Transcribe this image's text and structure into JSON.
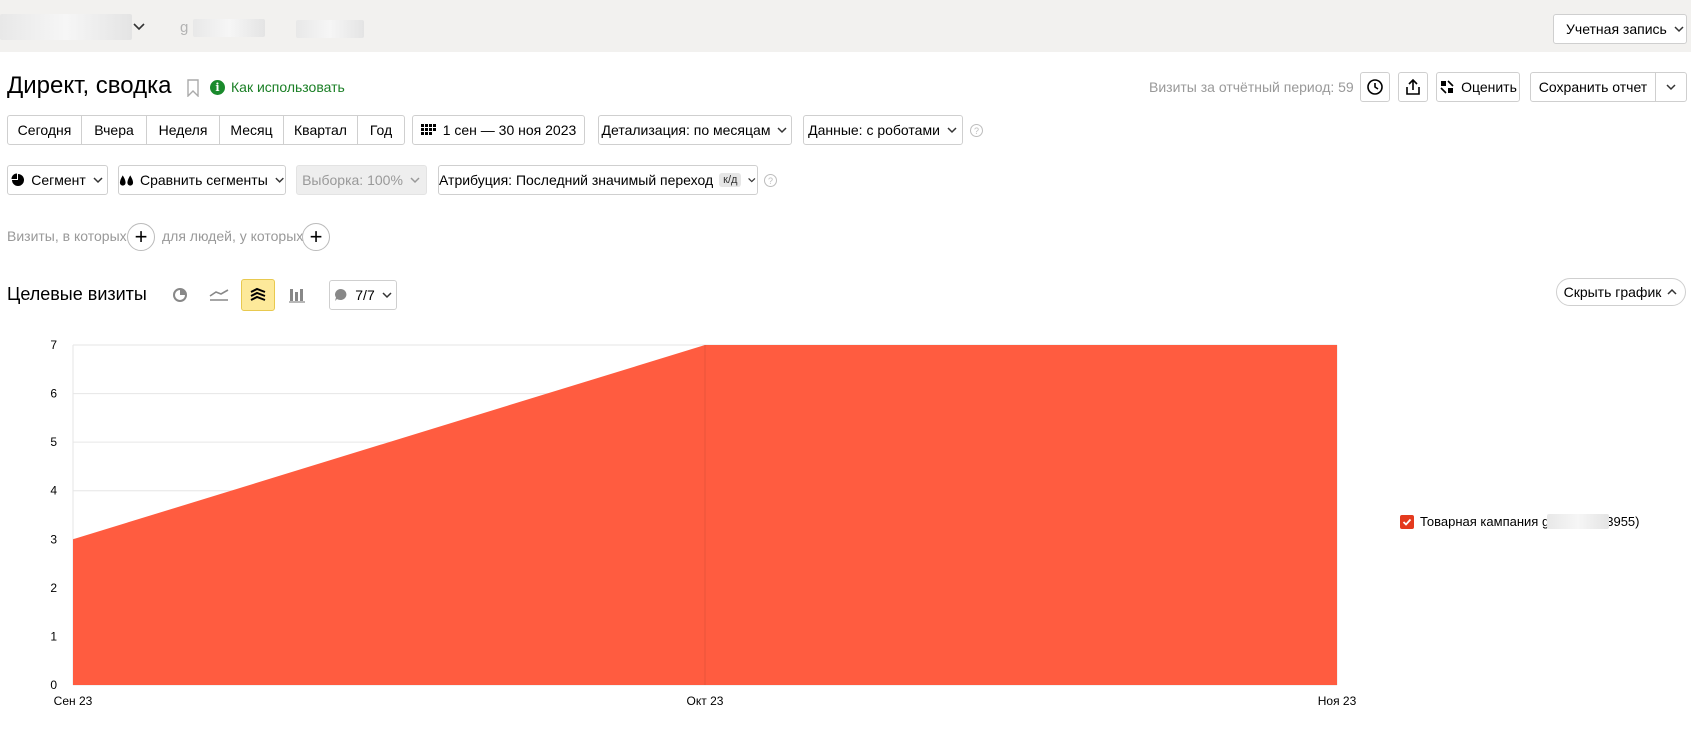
{
  "topbar": {
    "domain_text": "g                  .ru  •",
    "account_label": "Учетная запись"
  },
  "header": {
    "title": "Директ, сводка",
    "howto_label": "Как использовать",
    "visits_info": "Визиты за отчётный период: 59",
    "rate_label": "Оценить",
    "save_label": "Сохранить отчет"
  },
  "periods": {
    "items": [
      "Сегодня",
      "Вчера",
      "Неделя",
      "Месяц",
      "Квартал",
      "Год"
    ],
    "date_range": "1 сен — 30 ноя 2023",
    "detail": "Детализация: по месяцам",
    "data": "Данные: с роботами"
  },
  "segments": {
    "segment": "Сегмент",
    "compare": "Сравнить сегменты",
    "sample": "Выборка: 100%",
    "attribution": "Атрибуция: Последний значимый переход",
    "attribution_badge": "к/д"
  },
  "filters": {
    "visits_label": "Визиты, в которых",
    "people_label": "для людей, у которых"
  },
  "chart_header": {
    "title": "Целевые визиты",
    "annotations": "7/7",
    "hide_label": "Скрыть график"
  },
  "colors": {
    "series": "#ff5c40",
    "accent_green": "#1a8a2c",
    "active_tab": "#fde99a"
  },
  "chart_data": {
    "type": "area",
    "x": [
      "Сен 23",
      "Окт 23",
      "Ноя 23"
    ],
    "ylim": [
      0,
      7
    ],
    "yticks": [
      "0",
      "1",
      "2",
      "3",
      "4",
      "5",
      "6",
      "7"
    ],
    "grid": true,
    "legend_position": "right",
    "series": [
      {
        "name": "Товарная кампания g          l (N-89023955)",
        "values": [
          3,
          7,
          7
        ]
      }
    ]
  }
}
